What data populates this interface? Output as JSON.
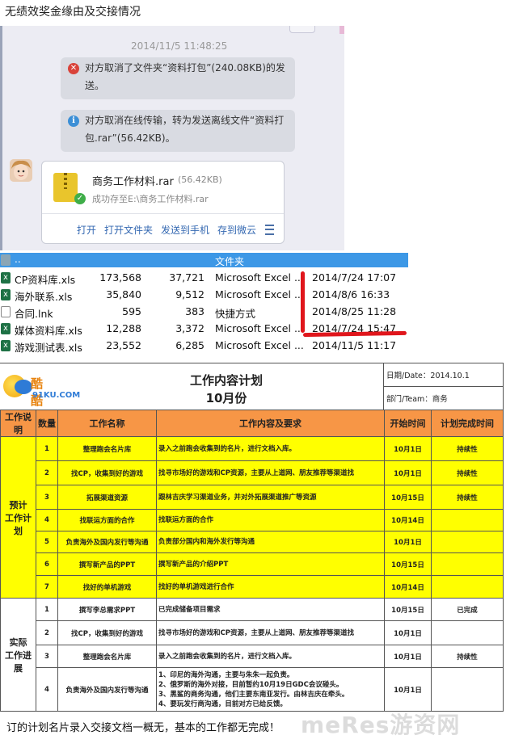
{
  "heading": "无绩效奖金缘由及交接情况",
  "chat": {
    "timestamp": "2014/11/5 11:48:25",
    "msg_cancel": "对方取消了文件夹“资料打包”(240.08KB)的发送。",
    "msg_offline": "对方取消在线传输，转为发送离线文件“资料打包.rar”(56.42KB)。",
    "file_card": {
      "name": "商务工作材料.rar",
      "size": "(56.42KB)",
      "saved": "成功存至E:\\商务工作材料.rar",
      "actions": [
        "打开",
        "打开文件夹",
        "发送到手机",
        "存到微云"
      ]
    },
    "colors": {
      "panel": "#ececf3",
      "bubble": "#d9dbe2",
      "link": "#3569b2"
    }
  },
  "file_list": {
    "parent": "..",
    "folder_label": "文件夹",
    "rows": [
      {
        "icon": "excel-icon",
        "name": "CP资料库.xls",
        "size": "173,568",
        "packed": "37,721",
        "type": "Microsoft Excel ...",
        "date": "2014/7/24 17:07"
      },
      {
        "icon": "excel-icon",
        "name": "海外联系.xls",
        "size": "35,840",
        "packed": "9,512",
        "type": "Microsoft Excel ...",
        "date": "2014/8/6 16:33"
      },
      {
        "icon": "shortcut-icon",
        "name": "合同.lnk",
        "size": "595",
        "packed": "383",
        "type": "快捷方式",
        "date": "2014/8/25 11:28"
      },
      {
        "icon": "excel-icon",
        "name": "媒体资料库.xls",
        "size": "12,288",
        "packed": "3,372",
        "type": "Microsoft Excel ...",
        "date": "2014/7/24 15:47"
      },
      {
        "icon": "excel-icon",
        "name": "游戏测试表.xls",
        "size": "23,552",
        "packed": "6,285",
        "type": "Microsoft Excel ...",
        "date": "2014/11/5 11:17"
      }
    ],
    "colors": {
      "header": "#3d98e6",
      "annotation": "#e0161c"
    }
  },
  "sheet": {
    "logo_name": "酷酷游戏",
    "logo_sub": "91KU.COM",
    "title": "工作内容计划",
    "month": "10月份",
    "date": "日期/Date：2014.10.1",
    "dept": "部门/Team：商务",
    "columns": [
      "工作说明",
      "数量",
      "工作名称",
      "工作内容及要求",
      "开始时间",
      "计划完成时间"
    ],
    "plan_category": "预计\n工作计划",
    "plan_rows": [
      {
        "no": "1",
        "name": "整理跑会名片库",
        "content": "录入之前跑会收集到的名片，进行文档入库。",
        "start": "10月1日",
        "finish": "持续性"
      },
      {
        "no": "2",
        "name": "找CP，收集到好的游戏",
        "content": "找寻市场好的游戏和CP资源，主要从上道网、朋友推荐等渠道找",
        "start": "10月1日",
        "finish": "持续性"
      },
      {
        "no": "3",
        "name": "拓展渠道资源",
        "content": "跟林吉庆学习渠道业务，并对外拓展渠道推广等资源",
        "start": "10月15日",
        "finish": "持续性"
      },
      {
        "no": "4",
        "name": "找联运方面的合作",
        "content": "找联运方面的合作",
        "start": "10月14日",
        "finish": ""
      },
      {
        "no": "5",
        "name": "负责海外及国内发行等沟通",
        "content": "负责部分国内和海外发行等沟通",
        "start": "10月1日",
        "finish": ""
      },
      {
        "no": "6",
        "name": "撰写新产品的PPT",
        "content": "撰写新产品的介绍PPT",
        "start": "10月15日",
        "finish": ""
      },
      {
        "no": "7",
        "name": "找好的单机游戏",
        "content": "找好的单机游戏进行合作",
        "start": "10月14日",
        "finish": ""
      }
    ],
    "actual_category": "实际\n工作进展",
    "actual_rows": [
      {
        "no": "1",
        "name": "撰写李总需求PPT",
        "content": "已完成储备项目需求",
        "start": "10月15日",
        "finish": "已完成"
      },
      {
        "no": "2",
        "name": "找CP，收集到好的游戏",
        "content": "找寻市场好的游戏和CP资源，主要从上道网、朋友推荐等渠道找",
        "start": "10月1日",
        "finish": ""
      },
      {
        "no": "3",
        "name": "整理跑会名片库",
        "content": "录入之前跑会收集到的名片，进行文档入库。",
        "start": "10月1日",
        "finish": "持续性"
      },
      {
        "no": "4",
        "name": "负责海外及国内发行等沟通",
        "content": "1、印尼的海外沟通，主要与朱朱一起负责。\n2、俄罗斯的海外对接，目前暂约10月19日GDC会议碰头。\n3、黑鲨的商务沟通，他们主要东南亚发行。由林吉庆在牵头。\n4、要玩发行商沟通，目前对方已给反馈。",
        "start": "10月1日",
        "finish": ""
      }
    ],
    "colors": {
      "header": "#f79646",
      "highlight": "#ffff00"
    }
  },
  "caption": "订的计划名片录入交接文档一概无，基本的工作都无完成！",
  "watermark": "meRes游资网"
}
